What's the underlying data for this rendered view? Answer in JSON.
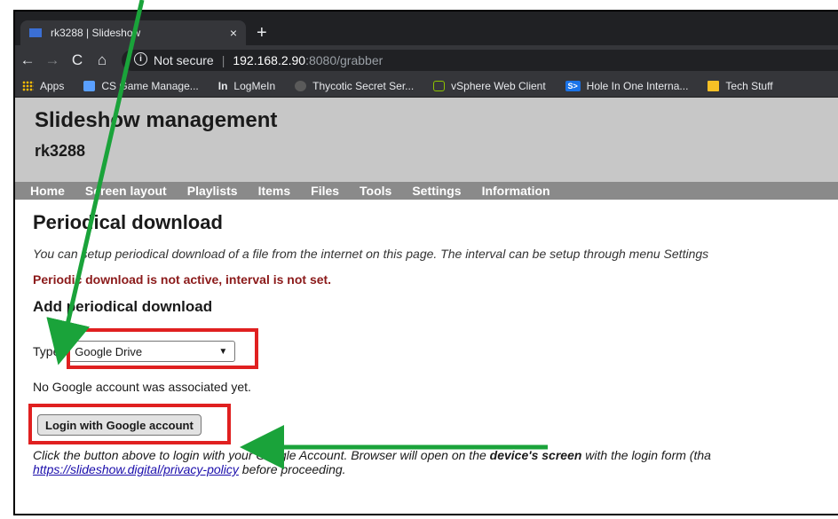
{
  "browser": {
    "tab": {
      "title": "rk3288 | Slideshow",
      "close": "×"
    },
    "new_tab": "+",
    "nav": {
      "back": "←",
      "forward": "→",
      "reload": "C",
      "home": "⌂"
    },
    "address": {
      "security_label": "Not secure",
      "separator": "|",
      "host": "192.168.2.90",
      "path": ":8080/grabber"
    },
    "bookmarks": [
      {
        "label": "Apps",
        "icon": "apps-icon"
      },
      {
        "label": "CS Game Manage...",
        "icon": "cs-icon"
      },
      {
        "label": "LogMeIn",
        "icon": "logmein-icon"
      },
      {
        "label": "Thycotic Secret Ser...",
        "icon": "thycotic-icon"
      },
      {
        "label": "vSphere Web Client",
        "icon": "vsphere-icon"
      },
      {
        "label": "Hole In One Interna...",
        "icon": "hole-in-one-icon"
      },
      {
        "label": "Tech Stuff",
        "icon": "folder-icon"
      }
    ]
  },
  "page": {
    "title": "Slideshow management",
    "device": "rk3288",
    "menu": [
      "Home",
      "Screen layout",
      "Playlists",
      "Items",
      "Files",
      "Tools",
      "Settings",
      "Information"
    ],
    "heading": "Periodical download",
    "intro": "You can setup periodical download of a file from the internet on this page. The interval can be setup through menu Settings",
    "warning": "Periodic download is not active, interval is not set.",
    "subheading": "Add periodical download",
    "type_label": "Type:",
    "type_value": "Google Drive",
    "no_account": "No Google account was associated yet.",
    "login_button": "Login with Google account",
    "footer": {
      "part1": "Click the button above to login with your Google Account. Browser will open on the ",
      "bold": "device's screen",
      "part2": " with the login form (tha",
      "link": "https://slideshow.digital/privacy-policy",
      "part3": " before proceeding."
    }
  },
  "annotations": {
    "highlight_color": "#e02020",
    "arrow_color": "#1aa33a"
  }
}
